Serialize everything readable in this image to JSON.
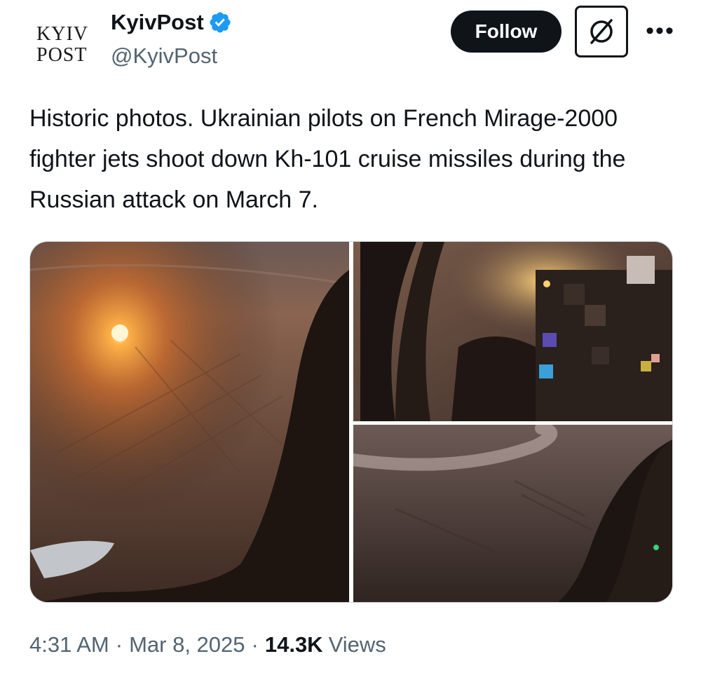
{
  "account": {
    "logo_line1": "KYIV",
    "logo_line2": "POST",
    "display_name": "KyivPost",
    "handle": "@KyivPost",
    "verified_color": "#1d9bf0"
  },
  "actions": {
    "follow_label": "Follow",
    "grok_icon": "grok-icon",
    "more_label": "•••"
  },
  "tweet": {
    "text": "Historic photos. Ukrainian pilots on French Mirage-2000 fighter jets shoot down Kh-101 cruise missiles during the Russian attack on March 7."
  },
  "meta": {
    "time": "4:31 AM",
    "date": "Mar 8, 2025",
    "views_count": "14.3K",
    "views_label": "Views",
    "separator": "·"
  }
}
